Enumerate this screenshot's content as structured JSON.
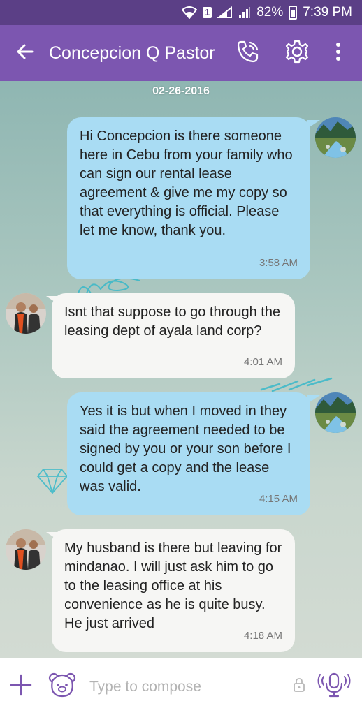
{
  "status_bar": {
    "battery": "82%",
    "time": "7:39 PM",
    "sim": "1"
  },
  "header": {
    "title": "Concepcion Q Pastor"
  },
  "chat": {
    "date": "02-26-2016",
    "messages": [
      {
        "direction": "outgoing",
        "text": "Hi Concepcion is there someone here in Cebu from your family who can sign our rental lease agreement & give me my copy so that everything is official. Please let me know, thank you.",
        "time": "3:58 AM"
      },
      {
        "direction": "incoming",
        "text": "Isnt that suppose to go through the leasing dept of ayala land corp?",
        "time": "4:01 AM"
      },
      {
        "direction": "outgoing",
        "text": "Yes it is but when I moved in they said the agreement needed to be signed by you or your son before I could get a copy and the lease was valid.",
        "time": "4:15 AM"
      },
      {
        "direction": "incoming",
        "text": "My husband is there but leaving for mindanao. I will just ask him to go to the leasing office at his convenience as he is quite busy. He just arrived",
        "time": "4:18 AM"
      }
    ]
  },
  "compose": {
    "placeholder": "Type to compose"
  },
  "colors": {
    "status_bar": "#5b3f86",
    "app_bar": "#7c56b0",
    "outgoing_bubble": "#a9dcf3",
    "incoming_bubble": "#f6f6f4",
    "accent": "#7c56b0"
  }
}
